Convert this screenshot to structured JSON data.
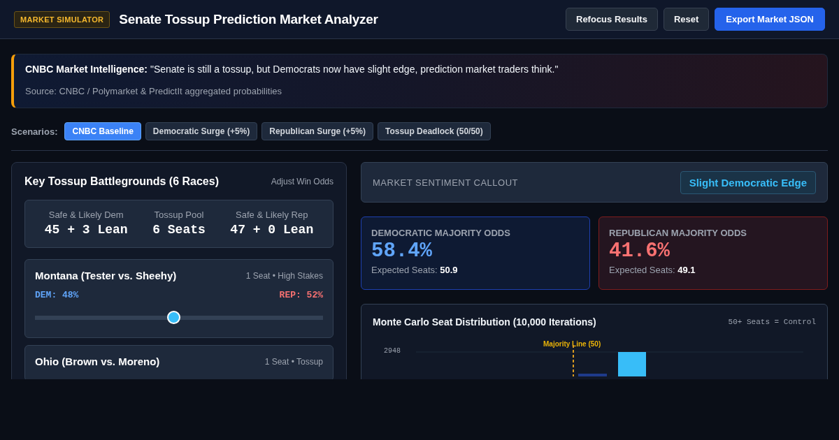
{
  "header": {
    "badge": "MARKET SIMULATOR",
    "title": "Senate Tossup Prediction Market Analyzer",
    "buttons": [
      {
        "label": "Refocus Results",
        "kind": "secondary"
      },
      {
        "label": "Reset",
        "kind": "secondary"
      },
      {
        "label": "Export Market JSON",
        "kind": "primary"
      }
    ]
  },
  "callout": {
    "text": "**CNBC Market Intelligence:** \"Senate is still a tossup, but Democrats now have slight edge, prediction market traders think.\"",
    "source": "Source: CNBC / Polymarket & PredictIt aggregated probabilities"
  },
  "scenarios": {
    "label": "Scenarios:",
    "items": [
      {
        "label": "CNBC Baseline",
        "selected": true
      },
      {
        "label": "Democratic Surge (+5%)",
        "selected": false
      },
      {
        "label": "Republican Surge (+5%)",
        "selected": false
      },
      {
        "label": "Tossup Deadlock (50/50)",
        "selected": false
      }
    ]
  },
  "battlegrounds": {
    "title": "Key Tossup Battlegrounds (6 Races)",
    "hint": "Adjust Win Odds",
    "summary": [
      {
        "label": "Safe & Likely Dem",
        "value": "45 + 3 Lean"
      },
      {
        "label": "Tossup Pool",
        "value": "6 Seats"
      },
      {
        "label": "Safe & Likely Rep",
        "value": "47 + 0 Lean"
      }
    ],
    "races": [
      {
        "name": "Montana (Tester vs. Sheehy)",
        "meta": "1 Seat • High Stakes",
        "dem": "DEM: 48%",
        "rep": "REP: 52%",
        "level": 0.48
      },
      {
        "name": "Ohio (Brown vs. Moreno)",
        "meta": "1 Seat • Tossup"
      }
    ]
  },
  "sentiment": {
    "label": "MARKET SENTIMENT CALLOUT",
    "value": "Slight Democratic Edge"
  },
  "odds": [
    {
      "kind": "dem",
      "title": "DEMOCRATIC MAJORITY ODDS",
      "value": "58.4%",
      "seats_label": "Expected Seats:",
      "seats": "50.9"
    },
    {
      "kind": "rep",
      "title": "REPUBLICAN MAJORITY ODDS",
      "value": "41.6%",
      "seats_label": "Expected Seats:",
      "seats": "49.1"
    }
  ],
  "distribution": {
    "title": "Monte Carlo Seat Distribution (10,000 Iterations)",
    "note": "50+ Seats = Control",
    "y_tick": "2948",
    "majority_label": "Majority Line (50)"
  }
}
